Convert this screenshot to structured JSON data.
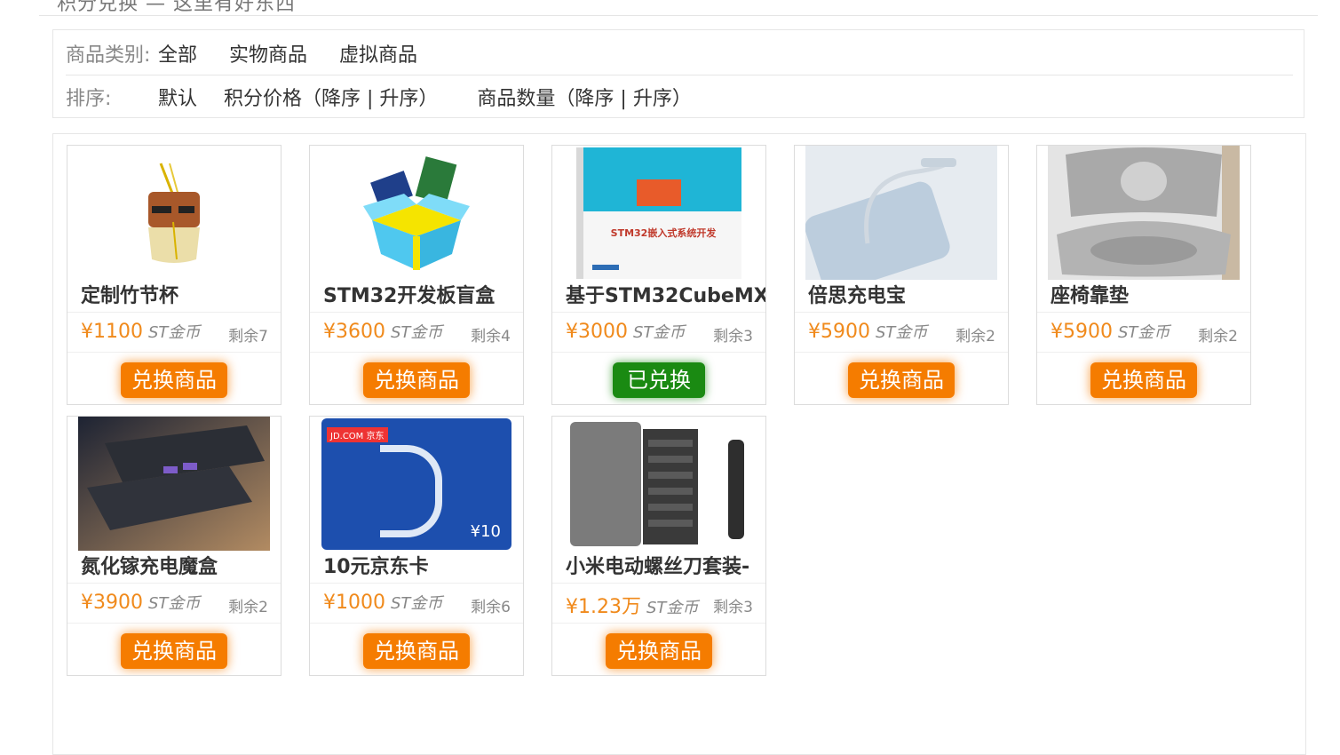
{
  "header": {
    "cut_text": "积分兑换 — 这里有好东西"
  },
  "filters": {
    "category_label": "商品类别:",
    "categories": [
      "全部",
      "实物商品",
      "虚拟商品"
    ],
    "sort_label": "排序:",
    "sort_default": "默认",
    "sort_price": "积分价格（降序 | 升序）",
    "sort_count": "商品数量（降序 | 升序）"
  },
  "unit": "ST金币",
  "products": [
    {
      "name": "定制竹节杯",
      "price": "¥1100",
      "stock": "剩余7",
      "button": "兑换商品",
      "redeemed": false,
      "icon": "bamboo-cup-icon"
    },
    {
      "name": "STM32开发板盲盒",
      "price": "¥3600",
      "stock": "剩余4",
      "button": "兑换商品",
      "redeemed": false,
      "icon": "blind-box-icon"
    },
    {
      "name": "基于STM32CubeMX",
      "price": "¥3000",
      "stock": "剩余3",
      "button": "已兑换",
      "redeemed": true,
      "icon": "book-icon",
      "book_title": "STM32嵌入式系统开发"
    },
    {
      "name": "倍思充电宝",
      "price": "¥5900",
      "stock": "剩余2",
      "button": "兑换商品",
      "redeemed": false,
      "icon": "power-bank-icon"
    },
    {
      "name": "座椅靠垫",
      "price": "¥5900",
      "stock": "剩余2",
      "button": "兑换商品",
      "redeemed": false,
      "icon": "seat-cushion-icon"
    },
    {
      "name": "氮化镓充电魔盒",
      "price": "¥3900",
      "stock": "剩余2",
      "button": "兑换商品",
      "redeemed": false,
      "icon": "charger-box-icon"
    },
    {
      "name": "10元京东卡",
      "price": "¥1000",
      "stock": "剩余6",
      "button": "兑换商品",
      "redeemed": false,
      "icon": "jd-card-icon",
      "card_brand": "JD.COM 京东",
      "card_value": "¥10"
    },
    {
      "name": "小米电动螺丝刀套装-",
      "price": "¥1.23万",
      "stock": "剩余3",
      "button": "兑换商品",
      "redeemed": false,
      "icon": "screwdriver-set-icon"
    }
  ]
}
